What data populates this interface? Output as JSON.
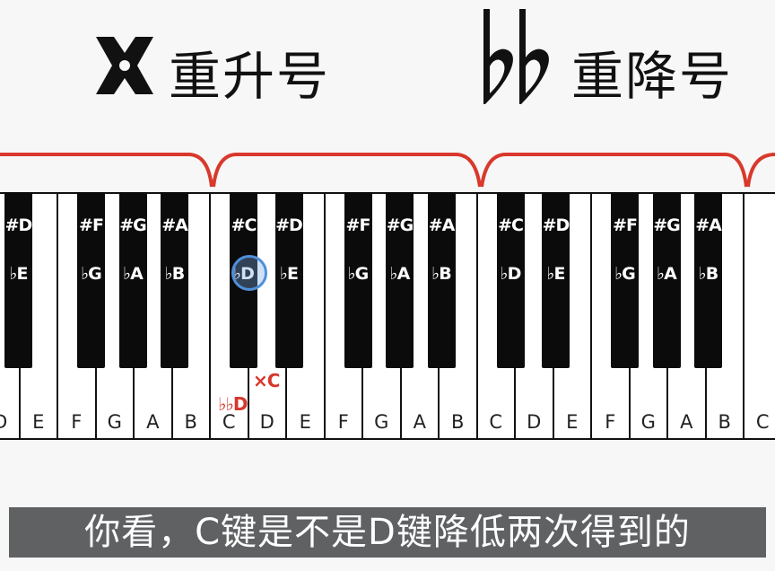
{
  "header": {
    "double_sharp_label": "重升号",
    "double_flat_label": "重降号",
    "double_sharp_symbol_text": "𝄪",
    "double_flat_symbol_text": "𝄫"
  },
  "keyboard": {
    "white_keys": [
      "D",
      "E",
      "F",
      "G",
      "A",
      "B",
      "C",
      "D",
      "E",
      "F",
      "G",
      "A",
      "B",
      "C",
      "D",
      "E",
      "F",
      "G",
      "A",
      "B",
      "C"
    ],
    "black_keys": [
      {
        "top": "#D",
        "bottom": "♭E"
      },
      {
        "top": "#F",
        "bottom": "♭G"
      },
      {
        "top": "#G",
        "bottom": "♭A"
      },
      {
        "top": "#A",
        "bottom": "♭B"
      },
      {
        "top": "#C",
        "bottom": "♭D"
      },
      {
        "top": "#D",
        "bottom": "♭E"
      },
      {
        "top": "#F",
        "bottom": "♭G"
      },
      {
        "top": "#G",
        "bottom": "♭A"
      },
      {
        "top": "#A",
        "bottom": "♭B"
      },
      {
        "top": "#C",
        "bottom": "♭D"
      },
      {
        "top": "#D",
        "bottom": "♭E"
      },
      {
        "top": "#F",
        "bottom": "♭G"
      },
      {
        "top": "#G",
        "bottom": "♭A"
      },
      {
        "top": "#A",
        "bottom": "♭B"
      }
    ],
    "annotation_double_flat_d": "♭♭D",
    "annotation_double_sharp_c": "×C",
    "highlight_color": "#4f8fd9",
    "annotation_color": "#d6372c",
    "bracket_color": "#d9382c"
  },
  "subtitle": {
    "text": "你看，C键是不是D键降低两次得到的"
  }
}
